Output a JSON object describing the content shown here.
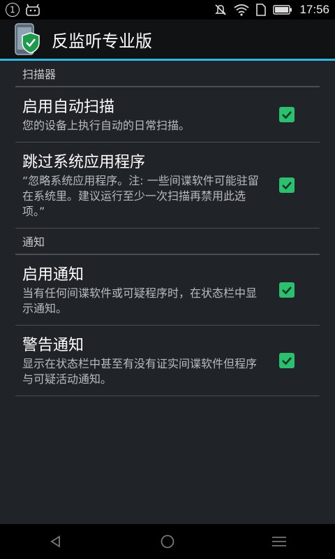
{
  "status_bar": {
    "notification_badge": "1",
    "time": "17:56",
    "icons": [
      "notification-count-icon",
      "android-icon",
      "mute-icon",
      "wifi-icon",
      "sim-icon",
      "battery-icon"
    ]
  },
  "action_bar": {
    "title": "反监听专业版",
    "accent_color": "#33b5e5"
  },
  "categories": [
    {
      "title": "扫描器",
      "items": [
        {
          "title": "启用自动扫描",
          "summary": "您的设备上执行自动的日常扫描。",
          "checked": true
        },
        {
          "title": "跳过系统应用程序",
          "summary": "“忽略系统应用程序。注: 一些间谍软件可能驻留在系统里。建议运行至少一次扫描再禁用此选项。”",
          "checked": true
        }
      ]
    },
    {
      "title": "通知",
      "items": [
        {
          "title": "启用通知",
          "summary": "当有任何间谍软件或可疑程序时，在状态栏中显示通知。",
          "checked": true
        },
        {
          "title": "警告通知",
          "summary": "显示在状态栏中甚至有没有证实间谍软件但程序与可疑活动通知。",
          "checked": true
        }
      ]
    }
  ],
  "checkbox_color": "#2bbf6f",
  "nav_bar": {
    "icons": [
      "back-icon",
      "home-icon",
      "menu-icon"
    ]
  }
}
